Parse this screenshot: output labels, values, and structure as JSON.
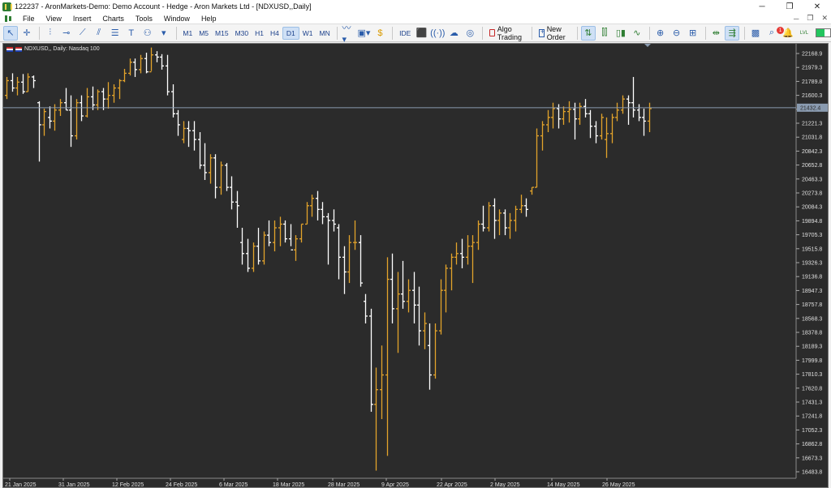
{
  "window": {
    "title": "122237 - AronMarkets-Demo: Demo Account - Hedge - Aron Markets Ltd - [NDXUSD,,Daily]",
    "buttons": {
      "minimize": "─",
      "restore": "❐",
      "close": "✕"
    }
  },
  "menu": {
    "items": [
      "File",
      "View",
      "Insert",
      "Charts",
      "Tools",
      "Window",
      "Help"
    ],
    "doc_buttons": {
      "minimize": "─",
      "restore": "❐",
      "close": "✕"
    }
  },
  "toolbar": {
    "timeframes": [
      "M1",
      "M5",
      "M15",
      "M30",
      "H1",
      "H4",
      "D1",
      "W1",
      "MN"
    ],
    "active_timeframe": "D1",
    "ide_label": "IDE",
    "algo_trading_label": "Algo Trading",
    "new_order_label": "New Order",
    "notification_count": "1",
    "level_label": "LVL"
  },
  "chart": {
    "label": "NDXUSD,, Daily:  Nasdaq 100",
    "current_price": "21432.4",
    "colors": {
      "background": "#2b2b2b",
      "bull": "#e3a32b",
      "bear": "#ffffff",
      "grid_line": "#8a9bb0"
    }
  },
  "chart_data": {
    "type": "ohlc",
    "instrument": "NDXUSD,",
    "timeframe": "Daily",
    "y_ticks": [
      "22168.9",
      "21979.3",
      "21789.8",
      "21600.3",
      "21410.8",
      "21221.3",
      "21031.8",
      "20842.3",
      "20652.8",
      "20463.3",
      "20273.8",
      "20084.3",
      "19894.8",
      "19705.3",
      "19515.8",
      "19326.3",
      "19136.8",
      "18947.3",
      "18757.8",
      "18568.3",
      "18378.8",
      "18189.3",
      "17999.8",
      "17810.3",
      "17620.8",
      "17431.3",
      "17241.8",
      "17052.3",
      "16862.8",
      "16673.3",
      "16483.8"
    ],
    "x_ticks": [
      "21 Jan 2025",
      "31 Jan 2025",
      "12 Feb 2025",
      "24 Feb 2025",
      "6 Mar 2025",
      "18 Mar 2025",
      "28 Mar 2025",
      "9 Apr 2025",
      "22 Apr 2025",
      "2 May 2025",
      "14 May 2025",
      "26 May 2025"
    ],
    "ylim": [
      16400,
      22200
    ],
    "bars": [
      [
        21600,
        21850,
        21550,
        21800
      ],
      [
        21800,
        21900,
        21650,
        21700
      ],
      [
        21700,
        21850,
        21600,
        21780
      ],
      [
        21780,
        21890,
        21620,
        21650
      ],
      [
        21650,
        21900,
        21650,
        21850
      ],
      [
        21850,
        21870,
        21700,
        21800
      ],
      [
        21500,
        21520,
        20700,
        21200
      ],
      [
        21200,
        21420,
        21050,
        21380
      ],
      [
        21300,
        21450,
        21150,
        21250
      ],
      [
        21250,
        21480,
        21120,
        21400
      ],
      [
        21400,
        21550,
        21320,
        21500
      ],
      [
        21500,
        21700,
        21400,
        21400
      ],
      [
        21400,
        21600,
        20900,
        21050
      ],
      [
        21050,
        21550,
        21000,
        21500
      ],
      [
        21500,
        21600,
        21250,
        21320
      ],
      [
        21320,
        21700,
        21300,
        21580
      ],
      [
        21580,
        21720,
        21400,
        21470
      ],
      [
        21470,
        21680,
        21400,
        21650
      ],
      [
        21650,
        21700,
        21400,
        21550
      ],
      [
        21550,
        21780,
        21420,
        21600
      ],
      [
        21600,
        21750,
        21500,
        21700
      ],
      [
        21700,
        21820,
        21550,
        21800
      ],
      [
        21800,
        21960,
        21780,
        21900
      ],
      [
        21900,
        22100,
        21870,
        22050
      ],
      [
        22050,
        22100,
        21850,
        21950
      ],
      [
        21950,
        22150,
        21900,
        22100
      ],
      [
        22100,
        22180,
        21900,
        21920
      ],
      [
        21920,
        22250,
        21930,
        22150
      ],
      [
        22150,
        22200,
        22050,
        22120
      ],
      [
        22120,
        22160,
        21950,
        22000
      ],
      [
        22000,
        22150,
        21600,
        21650
      ],
      [
        21650,
        21750,
        21300,
        21350
      ],
      [
        21350,
        21400,
        21050,
        21200
      ],
      [
        21000,
        21250,
        20950,
        21150
      ],
      [
        21150,
        21250,
        20900,
        21120
      ],
      [
        21120,
        21250,
        20850,
        21000
      ],
      [
        21000,
        21100,
        20600,
        20650
      ],
      [
        20650,
        20950,
        20450,
        20550
      ],
      [
        20550,
        20800,
        20400,
        20750
      ],
      [
        20750,
        20800,
        20200,
        20350
      ],
      [
        20350,
        20700,
        20250,
        20650
      ],
      [
        20650,
        20680,
        20300,
        20350
      ],
      [
        20350,
        20500,
        20050,
        20150
      ],
      [
        20150,
        20300,
        19800,
        20100
      ],
      [
        19600,
        19800,
        19300,
        19450
      ],
      [
        19450,
        19650,
        19200,
        19250
      ],
      [
        19250,
        19600,
        19200,
        19550
      ],
      [
        19550,
        19800,
        19300,
        19350
      ],
      [
        19350,
        19750,
        19300,
        19700
      ],
      [
        19700,
        19900,
        19550,
        19600
      ],
      [
        19600,
        19900,
        19480,
        19800
      ],
      [
        19800,
        19950,
        19550,
        19850
      ],
      [
        19850,
        19900,
        19600,
        19650
      ],
      [
        19650,
        19850,
        19550,
        19500
      ],
      [
        19500,
        19700,
        19350,
        19650
      ],
      [
        19650,
        19850,
        19600,
        19850
      ],
      [
        19850,
        20150,
        19850,
        20100
      ],
      [
        20100,
        20250,
        19950,
        20200
      ],
      [
        20200,
        20300,
        19900,
        20050
      ],
      [
        20050,
        20150,
        19850,
        19950
      ],
      [
        19950,
        20000,
        19300,
        19900
      ],
      [
        19900,
        20050,
        19750,
        19850
      ],
      [
        19800,
        19850,
        19100,
        19400
      ],
      [
        19400,
        19550,
        18900,
        19200
      ],
      [
        19200,
        19700,
        19050,
        19600
      ],
      [
        19600,
        19900,
        19500,
        19600
      ],
      [
        19600,
        19700,
        19000,
        19050
      ],
      [
        18800,
        18900,
        18500,
        18600
      ],
      [
        18600,
        18700,
        17300,
        17400
      ],
      [
        17400,
        17900,
        16500,
        17600
      ],
      [
        17600,
        18200,
        17200,
        17800
      ],
      [
        17800,
        19400,
        16700,
        19100
      ],
      [
        19100,
        19450,
        18500,
        18700
      ],
      [
        18700,
        19200,
        18100,
        18900
      ],
      [
        18900,
        19350,
        18700,
        18800
      ],
      [
        18800,
        19100,
        18650,
        18950
      ],
      [
        18950,
        19200,
        18500,
        18750
      ],
      [
        18750,
        19000,
        18200,
        18400
      ],
      [
        18400,
        18650,
        18150,
        18500
      ],
      [
        18200,
        18500,
        17600,
        17800
      ],
      [
        17800,
        18500,
        17750,
        18400
      ],
      [
        18400,
        19100,
        18350,
        18950
      ],
      [
        18950,
        19300,
        18650,
        19250
      ],
      [
        19250,
        19450,
        18950,
        19400
      ],
      [
        19400,
        19600,
        19300,
        19450
      ],
      [
        19450,
        19650,
        19250,
        19400
      ],
      [
        19400,
        19700,
        19300,
        19550
      ],
      [
        19550,
        19700,
        19050,
        19600
      ],
      [
        19600,
        19900,
        19500,
        19850
      ],
      [
        19850,
        20100,
        19750,
        19800
      ],
      [
        19800,
        20150,
        19750,
        20100
      ],
      [
        20100,
        20200,
        19650,
        19900
      ],
      [
        19900,
        20050,
        19700,
        20000
      ],
      [
        20000,
        20050,
        19700,
        19800
      ],
      [
        19800,
        20000,
        19650,
        19900
      ],
      [
        19900,
        20100,
        19750,
        20050
      ],
      [
        20050,
        20250,
        20000,
        20100
      ],
      [
        20100,
        20200,
        19950,
        20050
      ],
      [
        20300,
        20350,
        20250,
        20350
      ],
      [
        20350,
        21150,
        20350,
        21050
      ],
      [
        21050,
        21250,
        20850,
        21200
      ],
      [
        21200,
        21400,
        21100,
        21300
      ],
      [
        21300,
        21500,
        21150,
        21420
      ],
      [
        21420,
        21480,
        21150,
        21280
      ],
      [
        21280,
        21450,
        21200,
        21380
      ],
      [
        21380,
        21520,
        21230,
        21410
      ],
      [
        21410,
        21500,
        21000,
        21280
      ],
      [
        21280,
        21500,
        21200,
        21450
      ],
      [
        21450,
        21550,
        21300,
        21350
      ],
      [
        21350,
        21400,
        21020,
        21180
      ],
      [
        21180,
        21250,
        20950,
        21050
      ],
      [
        21050,
        21350,
        21000,
        21300
      ],
      [
        21000,
        21300,
        20750,
        21080
      ],
      [
        21080,
        21350,
        20950,
        21300
      ],
      [
        21300,
        21500,
        21250,
        21400
      ],
      [
        21400,
        21600,
        21350,
        21550
      ],
      [
        21550,
        21600,
        21200,
        21500
      ],
      [
        21500,
        21850,
        21300,
        21400
      ],
      [
        21400,
        21480,
        21250,
        21300
      ],
      [
        21300,
        21420,
        21050,
        21250
      ],
      [
        21250,
        21500,
        21100,
        21420
      ]
    ]
  }
}
